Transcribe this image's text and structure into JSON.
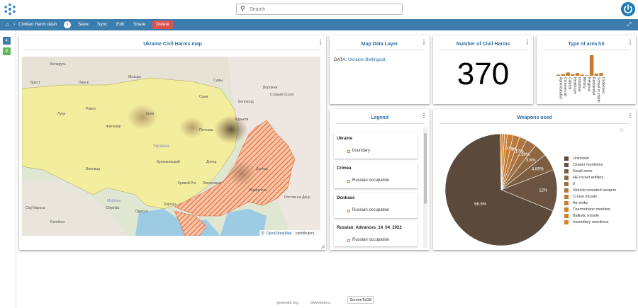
{
  "search": {
    "placeholder": "Search"
  },
  "nav": {
    "dashboard_name": "Civilian Harm dash",
    "save": "Save",
    "sync": "Sync",
    "edit": "Edit",
    "share": "Share",
    "delete": "Delete"
  },
  "map_panel": {
    "title": "Ukraine Civil Harms map",
    "attribution_prefix": "©",
    "attribution_link": "OpenStreetMap",
    "attribution_suffix": "contributors.",
    "labels": [
      "Беларусь",
      "Брест",
      "Пинск",
      "Мозырь",
      "Сумы",
      "Воронеж",
      "Луцк",
      "Ровно",
      "Житомир",
      "Киев",
      "Харьков",
      "Белгород",
      "Полтава",
      "Украина",
      "Днепр",
      "Кривой Рог",
      "Запорожье",
      "Донецк",
      "Винница",
      "Moldova",
      "Chișinău",
      "Одесса",
      "Cluj-Napoca",
      "România",
      "Ростов-на-Дону",
      "Старый Оскол",
      "Суми",
      "Кропивницкий",
      "Херсон",
      "Мариуполь"
    ]
  },
  "data_layer_panel": {
    "title": "Map Data Layer",
    "data_prefix": "DATA:",
    "data_link": "Ukraine Bellingcat"
  },
  "count_panel": {
    "title": "Number of Civil Harms",
    "value": "370"
  },
  "area_panel": {
    "title": "Type of area hit",
    "chart_data": {
      "type": "bar",
      "categories": [
        "Administrative",
        "Commercial",
        "Cultural",
        "Healthcare",
        "Industrial",
        "Military",
        "Religious",
        "Residential",
        "School or childcare",
        "Undefined"
      ],
      "values": [
        2,
        3,
        6,
        3,
        5,
        2,
        1,
        38,
        4,
        5
      ],
      "colors": [
        "#c47b2a",
        "#c47b2a",
        "#c47b2a",
        "#c47b2a",
        "#c47b2a",
        "#c47b2a",
        "#c47b2a",
        "#c47b2a",
        "#c47b2a",
        "#c47b2a"
      ]
    }
  },
  "legend_panel": {
    "title": "Legend",
    "layers": [
      {
        "name": "Ukraine",
        "item": "boundary"
      },
      {
        "name": "Crimea",
        "item": "Russian occupation"
      },
      {
        "name": "Donbass",
        "item": "Russian occupation"
      },
      {
        "name": "Russian_Advances_14_04_2022",
        "item": "Russian occupation"
      }
    ]
  },
  "weapons_panel": {
    "title": "Weapons used",
    "chart_data": {
      "type": "pie",
      "labels": [
        "Unknown",
        "Cluster munitions",
        "Small arms",
        "HE rocket artillery",
        "9",
        "Vehicle mounted weapon",
        "Cruise missile",
        "Air strike",
        "Thermobaric munition",
        "Ballistic missile",
        "Incendiary munitions"
      ],
      "values": [
        68.5,
        12,
        4.89,
        3.8,
        2.99,
        2.17,
        1.9,
        1.67,
        0.8,
        0.7,
        0.58
      ],
      "value_labels": [
        "68.5%",
        "12%",
        "4.89%",
        "3.8%",
        "2.99%",
        "2.17%",
        "1.9%",
        "1.67%",
        "",
        "",
        ""
      ],
      "colors": [
        "#5b4a3b",
        "#6a5441",
        "#7b5e42",
        "#8e6843",
        "#a07043",
        "#b07540",
        "#bc793a",
        "#c57c33",
        "#cc7f2d",
        "#d28229",
        "#d68426"
      ]
    }
  },
  "footer": {
    "link1": "geonode.org",
    "link2": "Developers",
    "badge": "ScreenToGif"
  }
}
